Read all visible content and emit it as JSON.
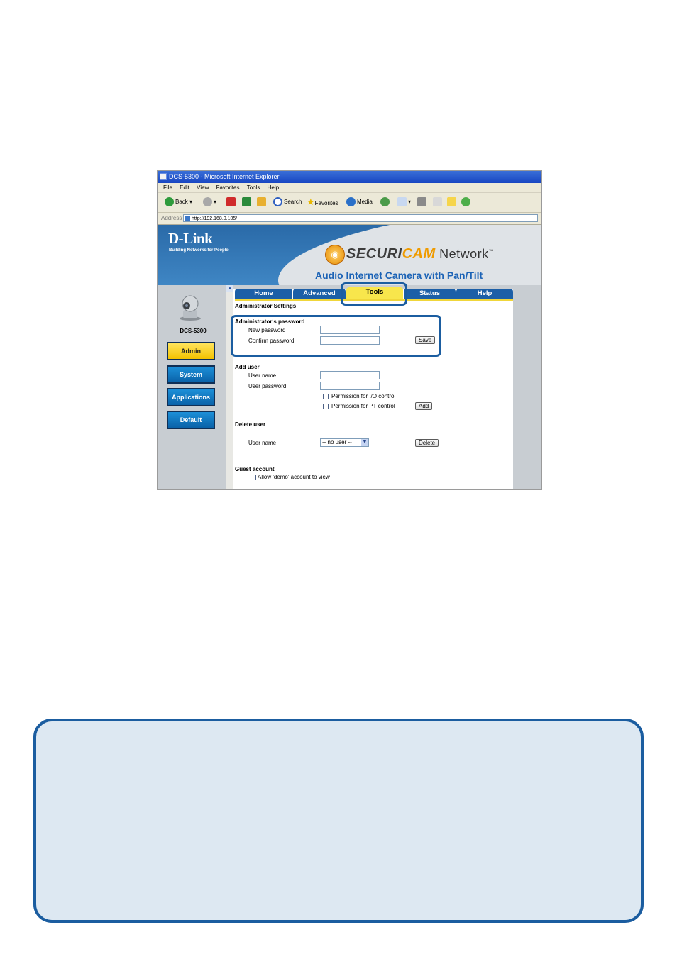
{
  "browser": {
    "window_title": "DCS-5300 - Microsoft Internet Explorer",
    "menu": [
      "File",
      "Edit",
      "View",
      "Favorites",
      "Tools",
      "Help"
    ],
    "toolbar": {
      "back": "Back",
      "search": "Search",
      "favorites": "Favorites",
      "media": "Media"
    },
    "address_label": "Address",
    "address_url": "http://192.168.0.105/"
  },
  "header": {
    "brand": "D-Link",
    "brand_tagline": "Building Networks for People",
    "product_brand_a": "SECURI",
    "product_brand_b": "CAM",
    "product_brand_c": " Network",
    "tm": "™",
    "product_tagline": "Audio Internet Camera with Pan/Tilt"
  },
  "sidebar": {
    "model": "DCS-5300",
    "buttons": [
      "Admin",
      "System",
      "Applications",
      "Default"
    ],
    "active": "Admin"
  },
  "tabs": [
    "Home",
    "Advanced",
    "Tools",
    "Status",
    "Help"
  ],
  "active_tab": "Tools",
  "admin": {
    "heading": "Administrator Settings",
    "password_section": "Administrator's password",
    "new_password_label": "New password",
    "confirm_password_label": "Confirm password",
    "save_button": "Save",
    "add_user_section": "Add user",
    "user_name_label": "User name",
    "user_password_label": "User password",
    "perm_io": "Permission for I/O control",
    "perm_pt": "Permission for PT control",
    "add_button": "Add",
    "delete_section": "Delete user",
    "delete_user_label": "User name",
    "delete_select_value": "-- no user --",
    "delete_button": "Delete",
    "guest_section": "Guest account",
    "guest_allow": "Allow 'demo' account to view"
  },
  "colors": {
    "highlight": "#1b5da0",
    "note_bg": "#dde8f2",
    "tab_active": "#f8e64c",
    "tab": "#1c5fa7"
  }
}
